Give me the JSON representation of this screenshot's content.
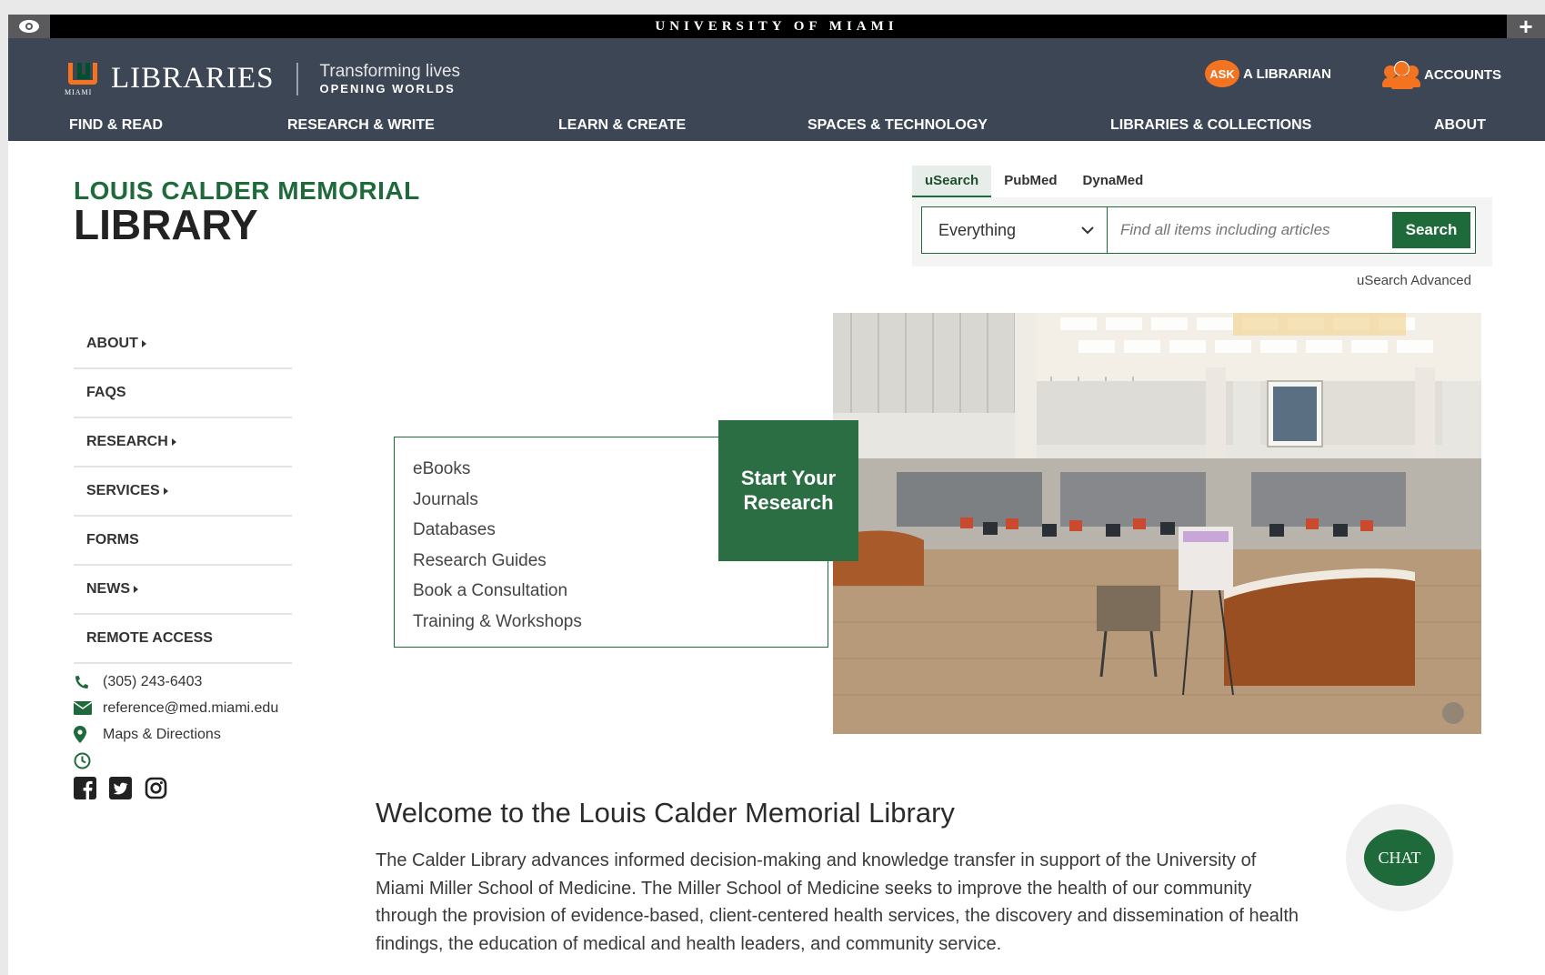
{
  "topbar": {
    "title": "UNIVERSITY OF MIAMI",
    "plus": "+"
  },
  "header": {
    "logo_text": "LIBRARIES",
    "logo_sub": "MIAMI",
    "tagline_1": "Transforming lives",
    "tagline_2": "OPENING WORLDS",
    "ask_badge": "ASK",
    "ask_label": "A LIBRARIAN",
    "accounts_label": "ACCOUNTS",
    "nav": [
      "FIND & READ",
      "RESEARCH & WRITE",
      "LEARN & CREATE",
      "SPACES & TECHNOLOGY",
      "LIBRARIES & COLLECTIONS",
      "ABOUT"
    ]
  },
  "library": {
    "name_line1": "LOUIS CALDER MEMORIAL",
    "name_line2": "LIBRARY"
  },
  "search": {
    "tabs": [
      "uSearch",
      "PubMed",
      "DynaMed"
    ],
    "active_tab": "uSearch",
    "scope": "Everything",
    "placeholder": "Find all items including articles",
    "button": "Search",
    "advanced": "uSearch Advanced"
  },
  "sidebar": {
    "items": [
      {
        "label": "ABOUT",
        "has_caret": true
      },
      {
        "label": "FAQS",
        "has_caret": false
      },
      {
        "label": "RESEARCH",
        "has_caret": true
      },
      {
        "label": "SERVICES",
        "has_caret": true
      },
      {
        "label": "FORMS",
        "has_caret": false
      },
      {
        "label": "NEWS",
        "has_caret": true
      },
      {
        "label": "REMOTE ACCESS",
        "has_caret": false
      }
    ],
    "phone": "(305) 243-6403",
    "email": "reference@med.miami.edu",
    "maps": "Maps & Directions"
  },
  "research": {
    "heading": "Start Your Research",
    "links": [
      "eBooks",
      "Journals",
      "Databases",
      "Research Guides",
      "Book a Consultation",
      "Training & Workshops"
    ]
  },
  "welcome": {
    "heading": "Welcome to the Louis Calder Memorial Library",
    "body": "The Calder Library advances informed decision-making and knowledge transfer in support of the University of Miami Miller School of Medicine. The Miller School of Medicine seeks to improve the health of our community through the provision of evidence-based, client-centered health services, the discovery and dissemination of health findings, the education of medical and health leaders, and community service."
  },
  "chat": {
    "label": "CHAT"
  },
  "colors": {
    "brand_green": "#1f6a3a",
    "brand_orange": "#f47321",
    "header_bg": "#3c4654"
  }
}
